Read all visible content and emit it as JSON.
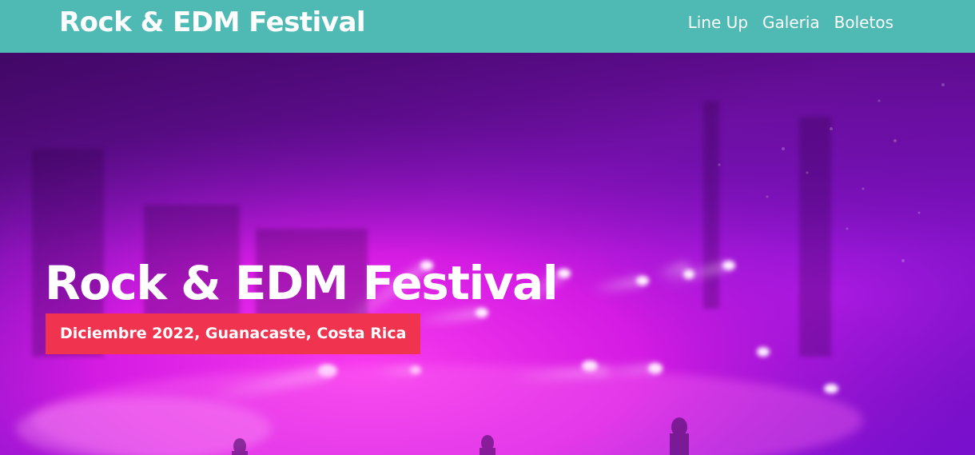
{
  "header": {
    "brand": "Rock & EDM Festival",
    "nav": [
      {
        "label": "Line Up"
      },
      {
        "label": "Galeria"
      },
      {
        "label": "Boletos"
      }
    ]
  },
  "hero": {
    "title": "Rock & EDM Festival",
    "subtitle": "Diciembre 2022, Guanacaste, Costa Rica"
  },
  "colors": {
    "header_bg": "#4fb9b4",
    "badge_bg": "#f0344f",
    "hero_magenta": "#e21de8",
    "hero_purple": "#5a0a9e",
    "text": "#ffffff"
  }
}
